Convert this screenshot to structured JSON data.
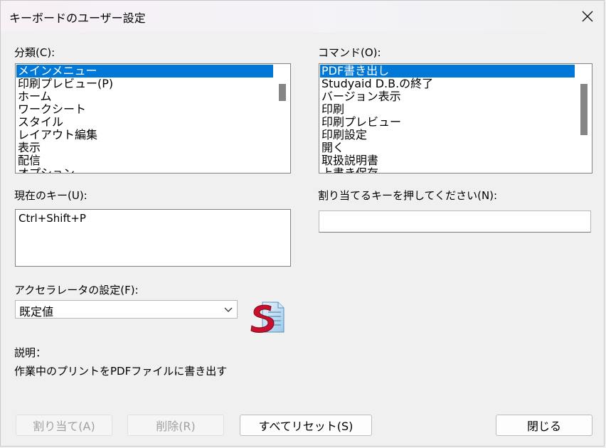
{
  "window": {
    "title": "キーボードのユーザー設定"
  },
  "categories": {
    "label": "分類(C):",
    "items": [
      "メインメニュー",
      "印刷プレビュー(P)",
      "ホーム",
      "ワークシート",
      "スタイル",
      "レイアウト編集",
      "表示",
      "配信",
      "オプション"
    ],
    "selected_index": 0
  },
  "commands": {
    "label": "コマンド(O):",
    "items": [
      "PDF書き出し",
      "Studyaid D.B.の終了",
      "バージョン表示",
      "印刷",
      "印刷プレビュー",
      "印刷設定",
      "開く",
      "取扱説明書",
      "上書き保存"
    ],
    "selected_index": 0
  },
  "current_keys": {
    "label": "現在のキー(U):",
    "value": "Ctrl+Shift+P"
  },
  "new_key": {
    "label": "割り当てるキーを押してください(N):",
    "value": ""
  },
  "accelerator": {
    "label": "アクセラレータの設定(F):",
    "value": "既定値"
  },
  "description": {
    "label": "説明：",
    "text": "作業中のプリントをPDFファイルに書き出す"
  },
  "buttons": {
    "assign": "割り当て(A)",
    "delete": "削除(R)",
    "reset_all": "すべてリセット(S)",
    "close": "閉じる"
  },
  "colors": {
    "selection": "#0078d7",
    "logo_red": "#c8102e"
  },
  "icons": {
    "close": "close-icon",
    "combo": "chevron-down-icon",
    "logo": "studyaid-logo-icon"
  }
}
